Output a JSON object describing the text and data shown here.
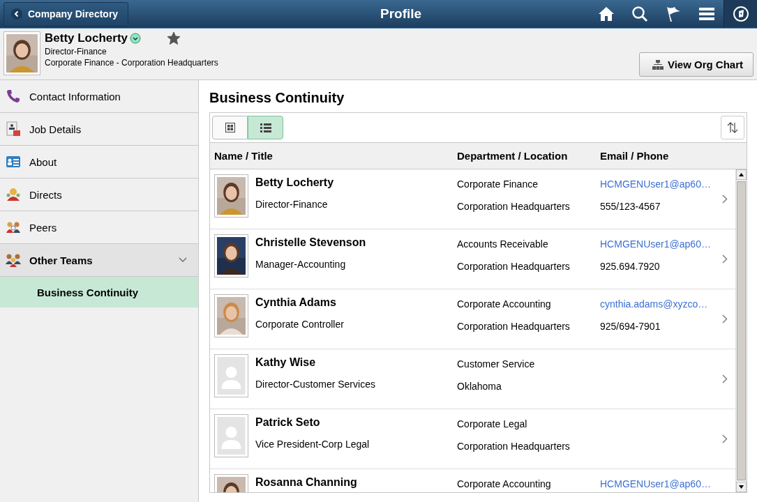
{
  "header": {
    "back_label": "Company Directory",
    "title": "Profile"
  },
  "profile": {
    "name": "Betty Locherty",
    "favorite": true,
    "title": "Director-Finance",
    "department": "Corporate Finance - Corporation Headquarters",
    "org_chart_button": "View Org Chart"
  },
  "sidebar": {
    "items": [
      {
        "label": "Contact Information",
        "selected": false
      },
      {
        "label": "Job Details",
        "selected": false
      },
      {
        "label": "About",
        "selected": false
      },
      {
        "label": "Directs",
        "selected": false
      },
      {
        "label": "Peers",
        "selected": false
      },
      {
        "label": "Other Teams",
        "selected": true,
        "expanded": true,
        "children": [
          {
            "label": "Business Continuity",
            "selected": true
          }
        ]
      }
    ]
  },
  "content": {
    "title": "Business Continuity",
    "views": [
      {
        "kind": "grid",
        "selected": false
      },
      {
        "kind": "list",
        "selected": true
      }
    ],
    "table": {
      "columns": [
        "Name / Title",
        "Department / Location",
        "Email / Phone"
      ],
      "rows": [
        {
          "kind": "picture",
          "name": "Betty Locherty",
          "title": "Director-Finance",
          "department": "Corporate Finance",
          "location": "Corporation Headquarters",
          "email": "HCMGENUser1@ap60…",
          "phone": "555/123-4567"
        },
        {
          "kind": "picture",
          "name": "Christelle Stevenson",
          "title": "Manager-Accounting",
          "department": "Accounts Receivable",
          "location": "Corporation Headquarters",
          "email": "HCMGENUser1@ap60…",
          "phone": "925.694.7920"
        },
        {
          "kind": "picture",
          "name": "Cynthia Adams",
          "title": "Corporate Controller",
          "department": "Corporate Accounting",
          "location": "Corporation Headquarters",
          "email": "cynthia.adams@xyzco…",
          "phone": "925/694-7901"
        },
        {
          "kind": "placeholder",
          "name": "Kathy Wise",
          "title": "Director-Customer Services",
          "department": "Customer Service",
          "location": "Oklahoma"
        },
        {
          "kind": "placeholder",
          "name": "Patrick Seto",
          "title": "Vice President-Corp Legal",
          "department": "Corporate Legal",
          "location": "Corporation Headquarters"
        },
        {
          "kind": "picture",
          "name": "Rosanna Channing",
          "department": "Corporate Accounting",
          "email": "HCMGENUser1@ap60…"
        }
      ]
    }
  }
}
